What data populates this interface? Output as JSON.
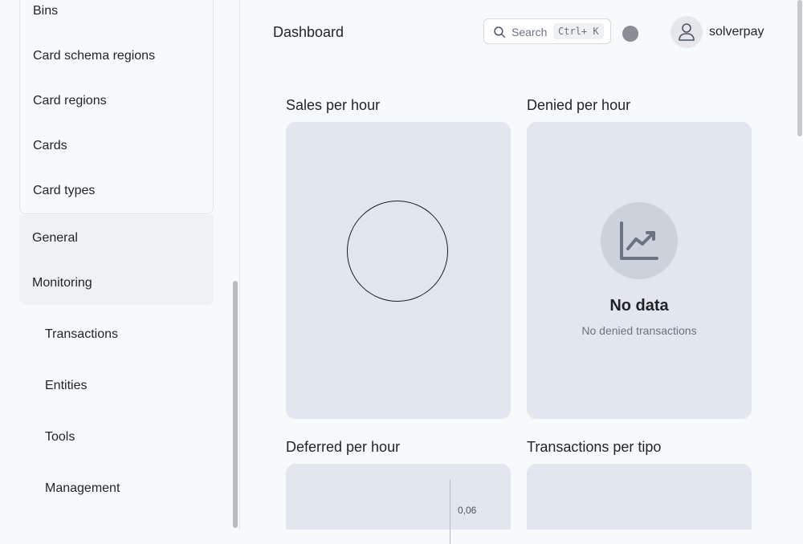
{
  "sidebar": {
    "sub_items": [
      "Bins",
      "Card schema regions",
      "Card regions",
      "Cards",
      "Card types"
    ],
    "group_items": [
      "General",
      "Monitoring"
    ],
    "nav_items": [
      "Transactions",
      "Entities",
      "Tools",
      "Management"
    ]
  },
  "header": {
    "title": "Dashboard",
    "search_placeholder": "Search",
    "search_shortcut": "Ctrl+ K",
    "username": "solverpay"
  },
  "cards": {
    "sales": {
      "title": "Sales per hour"
    },
    "denied": {
      "title": "Denied per hour",
      "empty_title": "No data",
      "empty_subtitle": "No denied transactions"
    },
    "deferred": {
      "title": "Deferred per hour",
      "axis_tick": "0,06"
    },
    "types": {
      "title": "Transactions per tipo"
    }
  },
  "icons": {
    "search": "search-icon",
    "avatar": "user-icon",
    "empty": "chart-trend-icon"
  },
  "colors": {
    "card_bg": "#e2e7ef",
    "page_bg": "#f8f9fb"
  }
}
